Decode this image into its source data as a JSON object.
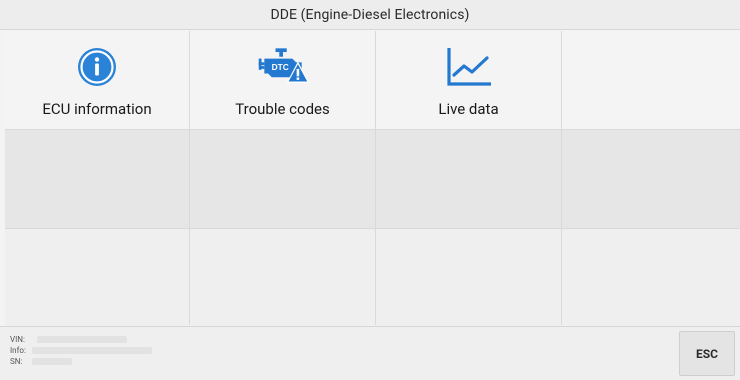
{
  "header": {
    "title": "DDE (Engine-Diesel Electronics)"
  },
  "functions": [
    {
      "label": "ECU information",
      "icon": "info-circle-icon"
    },
    {
      "label": "Trouble codes",
      "icon": "dtc-engine-warning-icon",
      "icon_text": "DTC"
    },
    {
      "label": "Live data",
      "icon": "line-chart-icon"
    }
  ],
  "footer": {
    "vin_label": "VIN:",
    "info_label": "Info:",
    "sn_label": "SN:",
    "esc_label": "ESC"
  },
  "colors": {
    "accent": "#2b7fd4",
    "icon_blue": "#2378cf"
  }
}
